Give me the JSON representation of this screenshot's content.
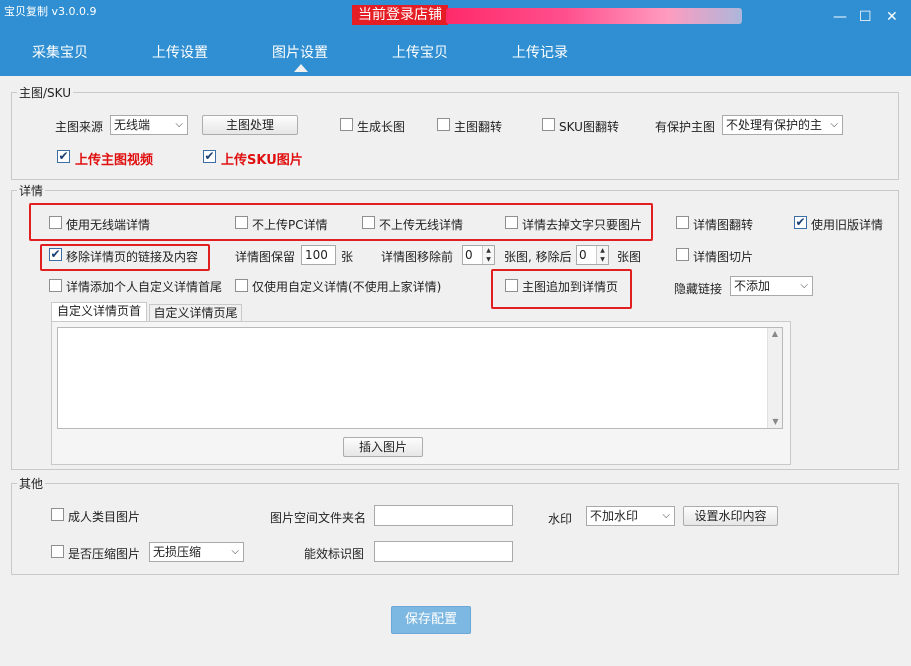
{
  "app": {
    "title": "宝贝复制 v3.0.0.9",
    "shop_label": "当前登录店铺"
  },
  "window": {
    "min": "—",
    "max": "☐",
    "close": "✕"
  },
  "tabs": [
    "采集宝贝",
    "上传设置",
    "图片设置",
    "上传宝贝",
    "上传记录"
  ],
  "active_tab": "图片设置",
  "main_sku": {
    "title": "主图/SKU",
    "source_label": "主图来源",
    "source_value": "无线端",
    "process_btn": "主图处理",
    "gen_long": "生成长图",
    "main_flip": "主图翻转",
    "sku_flip": "SKU图翻转",
    "protect_label": "有保护主图",
    "protect_value": "不处理有保护的主",
    "upload_video": "上传主图视频",
    "upload_sku": "上传SKU图片"
  },
  "detail": {
    "title": "详情",
    "use_wireless": "使用无线端详情",
    "no_pc": "不上传PC详情",
    "no_wireless": "不上传无线详情",
    "remove_text": "详情去掉文字只要图片",
    "detail_flip": "详情图翻转",
    "use_old": "使用旧版详情",
    "remove_links": "移除详情页的链接及内容",
    "keep_label": "详情图保留",
    "keep_value": "100",
    "unit_zhang": "张",
    "remove_before_label": "详情图移除前",
    "remove_before_value": "0",
    "mid_label": "张图, 移除后",
    "remove_after_value": "0",
    "end_label": "张图",
    "cut": "详情图切片",
    "add_custom": "详情添加个人自定义详情首尾",
    "only_custom": "仅使用自定义详情(不使用上家详情)",
    "append_main": "主图追加到详情页",
    "hidden_label": "隐藏链接",
    "hidden_value": "不添加",
    "subtab_head": "自定义详情页首",
    "subtab_tail": "自定义详情页尾",
    "insert_btn": "插入图片"
  },
  "other": {
    "title": "其他",
    "adult": "成人类目图片",
    "folder_label": "图片空间文件夹名",
    "folder_value": "",
    "watermark_label": "水印",
    "watermark_value": "不加水印",
    "watermark_btn": "设置水印内容",
    "compress": "是否压缩图片",
    "compress_value": "无损压缩",
    "efficacy_label": "能效标识图",
    "efficacy_value": ""
  },
  "save_btn": "保存配置",
  "colors": {
    "header": "#2f8fd2",
    "accent_red": "#e02020",
    "save": "#7db8e2"
  }
}
